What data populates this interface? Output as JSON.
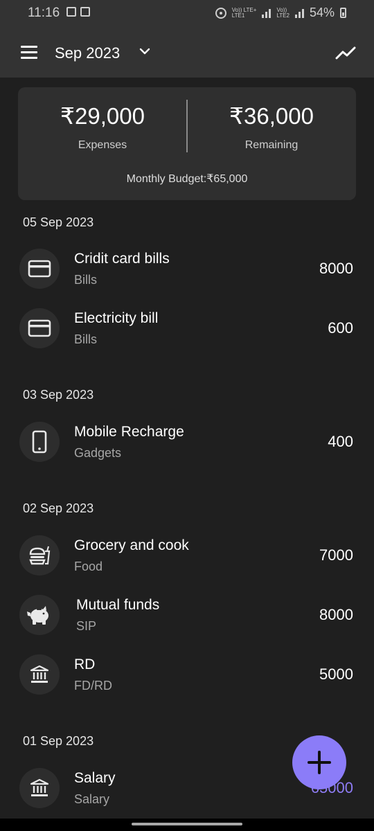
{
  "status_bar": {
    "time": "11:16",
    "network_labels": [
      "Vo)) LTE+",
      "LTE1",
      "Vo))",
      "LTE2"
    ],
    "battery": "54%"
  },
  "header": {
    "month": "Sep 2023",
    "menu_icon": "menu-icon",
    "dropdown_icon": "chevron-down-icon",
    "chart_icon": "trending-icon"
  },
  "summary": {
    "expenses_amount": "₹29,000",
    "expenses_label": "Expenses",
    "remaining_amount": "₹36,000",
    "remaining_label": "Remaining",
    "budget": "Monthly Budget:₹65,000"
  },
  "groups": [
    {
      "date": "05 Sep 2023",
      "items": [
        {
          "title": "Cridit card bills",
          "category": "Bills",
          "amount": "8000",
          "icon": "credit-card-icon"
        },
        {
          "title": "Electricity bill",
          "category": "Bills",
          "amount": "600",
          "icon": "credit-card-icon"
        }
      ]
    },
    {
      "date": "03 Sep 2023",
      "items": [
        {
          "title": "Mobile Recharge",
          "category": "Gadgets",
          "amount": "400",
          "icon": "phone-icon"
        }
      ]
    },
    {
      "date": "02 Sep 2023",
      "items": [
        {
          "title": "Grocery and cook",
          "category": "Food",
          "amount": "7000",
          "icon": "food-icon"
        },
        {
          "title": "Mutual funds",
          "category": "SIP",
          "amount": "8000",
          "icon": "piggy-bank-icon"
        },
        {
          "title": "RD",
          "category": "FD/RD",
          "amount": "5000",
          "icon": "bank-icon"
        }
      ]
    },
    {
      "date": "01 Sep 2023",
      "items": [
        {
          "title": "Salary",
          "category": "Salary",
          "amount": "65000",
          "icon": "bank-icon",
          "type": "income"
        }
      ]
    }
  ],
  "fab_icon": "plus-icon",
  "colors": {
    "background": "#1f1f1f",
    "appbar": "#333333",
    "card": "#2f2f2f",
    "accent": "#8b7cf8",
    "income": "#8e7cf4"
  }
}
